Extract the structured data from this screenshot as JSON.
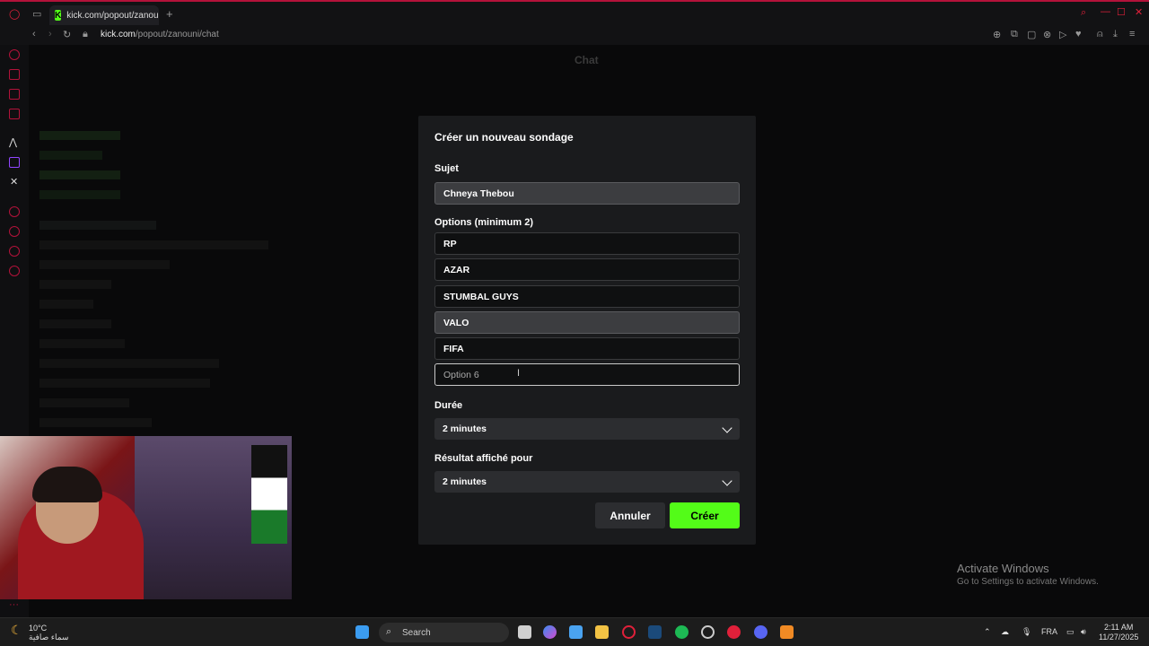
{
  "browser": {
    "tab_title": "kick.com/popout/zanouni",
    "address_host": "kick.com",
    "address_path": "/popout/zanouni/chat",
    "new_tab": "+"
  },
  "background": {
    "chat_title": "Chat"
  },
  "poll_dialog": {
    "title": "Créer un nouveau sondage",
    "subject_label": "Sujet",
    "subject_value": "Chneya Thebou",
    "options_label": "Options (minimum 2)",
    "options": [
      "RP",
      "AZAR",
      "STUMBAL GUYS",
      "VALO",
      "FIFA"
    ],
    "option6_placeholder": "Option 6",
    "duration_label": "Durée",
    "duration_value": "2 minutes",
    "result_label": "Résultat affiché pour",
    "result_value": "2 minutes",
    "cancel_label": "Annuler",
    "create_label": "Créer",
    "accent_color": "#53fc18"
  },
  "watermark": {
    "line1": "Activate Windows",
    "line2": "Go to Settings to activate Windows."
  },
  "taskbar": {
    "weather_temp": "10°C",
    "weather_desc": "سماء صافية",
    "search_label": "Search",
    "language": "FRA",
    "time": "2:11 AM",
    "date": "11/27/2025"
  }
}
